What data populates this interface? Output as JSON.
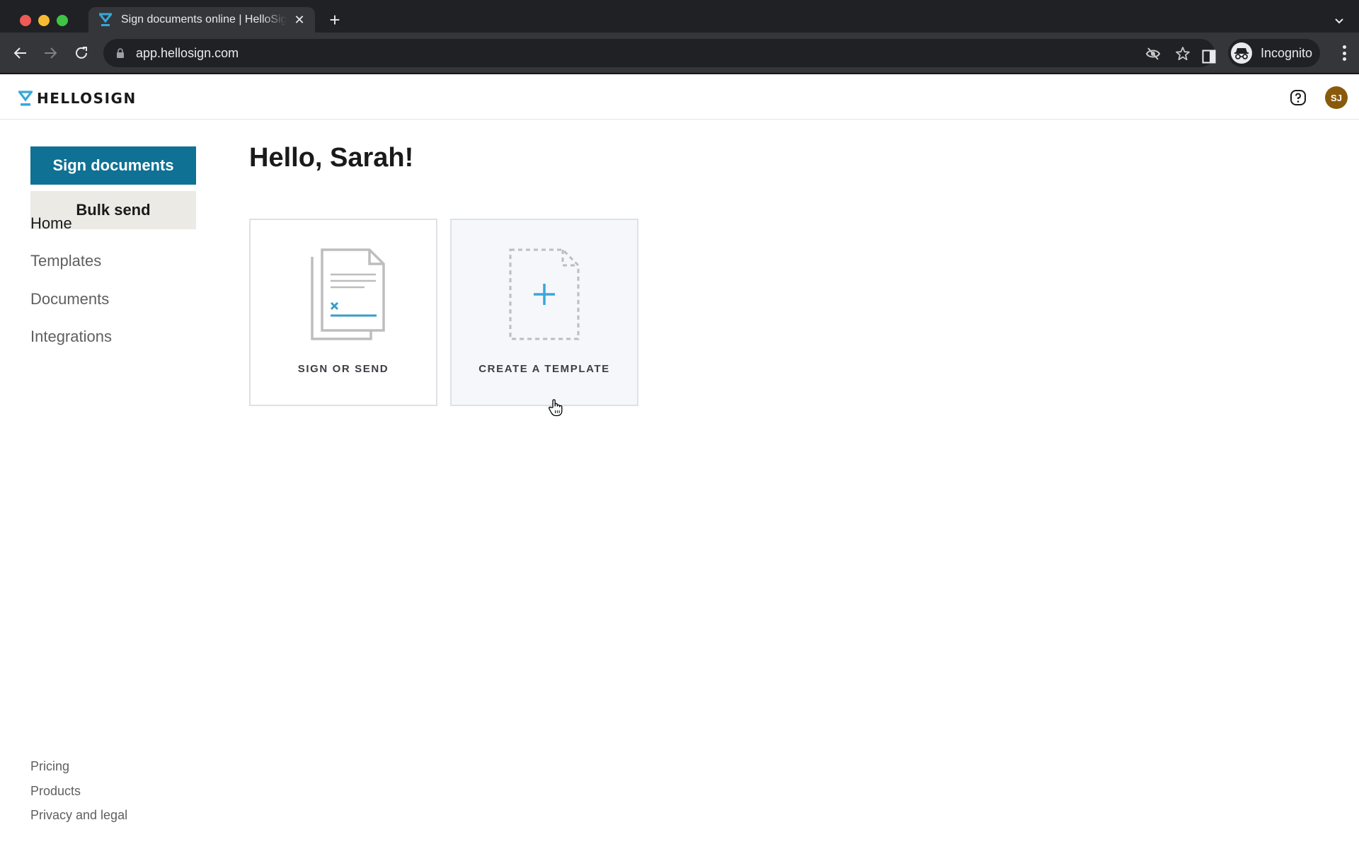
{
  "browser": {
    "tab_title": "Sign documents online | HelloSign",
    "url": "app.hellosign.com",
    "profile_label": "Incognito",
    "icons": {
      "close_tab": "close-icon",
      "new_tab": "plus-icon",
      "tab_search": "chevron-down-icon",
      "back": "arrow-left-icon",
      "forward": "arrow-right-icon",
      "reload": "reload-icon",
      "lock": "lock-icon",
      "tracking": "eye-off-icon",
      "bookmark": "star-icon",
      "side_panel": "side-panel-icon",
      "incognito": "incognito-icon",
      "menu": "kebab-menu-icon"
    }
  },
  "app": {
    "logo_text": "HELLOSIGN",
    "brand_color": "#0f7194",
    "accent_color": "#37a8d9",
    "user_initials": "SJ",
    "avatar_color": "#8a5a0c"
  },
  "sidebar": {
    "primary_button": "Sign documents",
    "secondary_button": "Bulk send",
    "nav": [
      {
        "label": "Home",
        "active": true
      },
      {
        "label": "Templates",
        "active": false
      },
      {
        "label": "Documents",
        "active": false
      },
      {
        "label": "Integrations",
        "active": false
      }
    ],
    "footer": [
      {
        "label": "Pricing"
      },
      {
        "label": "Products"
      },
      {
        "label": "Privacy and legal"
      }
    ]
  },
  "main": {
    "greeting": "Hello, Sarah!",
    "cards": [
      {
        "label": "SIGN OR SEND",
        "icon": "document-sign-icon"
      },
      {
        "label": "CREATE A TEMPLATE",
        "icon": "new-template-icon"
      }
    ]
  }
}
